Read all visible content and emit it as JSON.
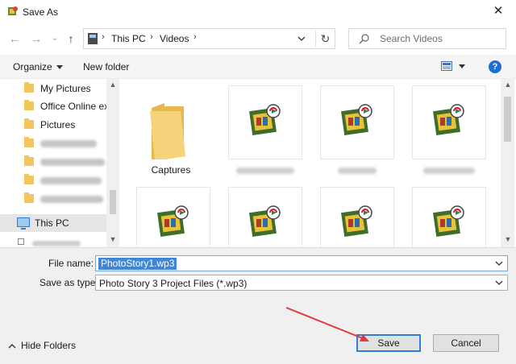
{
  "window": {
    "title": "Save As",
    "close_glyph": "✕"
  },
  "nav_buttons": {
    "back_glyph": "←",
    "forward_glyph": "→",
    "recent_glyph": "⌄",
    "up_glyph": "↑"
  },
  "address": {
    "icon": "this-pc-icon",
    "segments": [
      "This PC",
      "Videos"
    ],
    "separator": "›",
    "refresh_glyph": "↻"
  },
  "search": {
    "placeholder": "Search Videos"
  },
  "toolbar": {
    "organize_label": "Organize",
    "new_folder_label": "New folder",
    "help_glyph": "?"
  },
  "sidebar": {
    "items": [
      {
        "label": "My Pictures",
        "type": "folder"
      },
      {
        "label": "Office Online ex",
        "type": "folder"
      },
      {
        "label": "Pictures",
        "type": "folder"
      },
      {
        "label": "",
        "type": "folder-blurred"
      },
      {
        "label": "",
        "type": "folder-blurred"
      },
      {
        "label": "",
        "type": "folder-blurred"
      },
      {
        "label": "",
        "type": "folder-blurred"
      },
      {
        "label": "This PC",
        "type": "computer",
        "selected": true
      }
    ]
  },
  "files": [
    {
      "name": "Captures",
      "type": "folder"
    },
    {
      "name": "",
      "type": "photostory",
      "caption_blurred": true
    },
    {
      "name": "",
      "type": "photostory",
      "caption_blurred": true
    },
    {
      "name": "",
      "type": "photostory",
      "caption_blurred": true
    },
    {
      "name": "",
      "type": "photostory"
    },
    {
      "name": "",
      "type": "photostory"
    },
    {
      "name": "",
      "type": "photostory"
    },
    {
      "name": "",
      "type": "photostory"
    }
  ],
  "form": {
    "file_name_label": "File name:",
    "file_name_value": "PhotoStory1.wp3",
    "save_type_label": "Save as type:",
    "save_type_value": "Photo Story 3 Project Files (*.wp3)"
  },
  "footer": {
    "hide_folders_label": "Hide Folders",
    "save_label": "Save",
    "cancel_label": "Cancel"
  },
  "colors": {
    "accent": "#2e7fd8",
    "selection": "#3f87d6",
    "folder": "#f1c75b",
    "annotation_arrow": "#e03a3e"
  }
}
